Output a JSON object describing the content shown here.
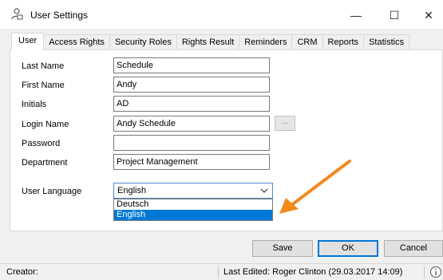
{
  "window": {
    "title": "User Settings",
    "minimize_glyph": "—",
    "maximize_glyph": "☐",
    "close_glyph": "✕"
  },
  "tabs": [
    {
      "label": "User",
      "active": true
    },
    {
      "label": "Access Rights",
      "active": false
    },
    {
      "label": "Security Roles",
      "active": false
    },
    {
      "label": "Rights Result",
      "active": false
    },
    {
      "label": "Reminders",
      "active": false
    },
    {
      "label": "CRM",
      "active": false
    },
    {
      "label": "Reports",
      "active": false
    },
    {
      "label": "Statistics",
      "active": false
    }
  ],
  "form": {
    "last_name": {
      "label": "Last Name",
      "value": "Schedule"
    },
    "first_name": {
      "label": "First Name",
      "value": "Andy"
    },
    "initials": {
      "label": "Initials",
      "value": "AD"
    },
    "login_name": {
      "label": "Login Name",
      "value": "Andy Schedule",
      "browse_label": "..."
    },
    "password": {
      "label": "Password",
      "value": ""
    },
    "department": {
      "label": "Department",
      "value": "Project Management"
    },
    "user_language": {
      "label": "User Language",
      "selected": "English",
      "options": [
        {
          "label": "Deutsch",
          "selected": false
        },
        {
          "label": "English",
          "selected": true
        }
      ]
    }
  },
  "buttons": {
    "save": "Save",
    "ok": "OK",
    "cancel": "Cancel"
  },
  "status": {
    "creator": "Creator:",
    "last_edited": "Last Edited:  Roger Clinton (29.03.2017 14:09)"
  },
  "icons": {
    "title_icon": "user-settings-icon",
    "info_icon": "info-icon",
    "annotation": "orange-arrow-annotation"
  },
  "colors": {
    "accent": "#0078d7",
    "annotation_arrow": "#f28a1e"
  }
}
